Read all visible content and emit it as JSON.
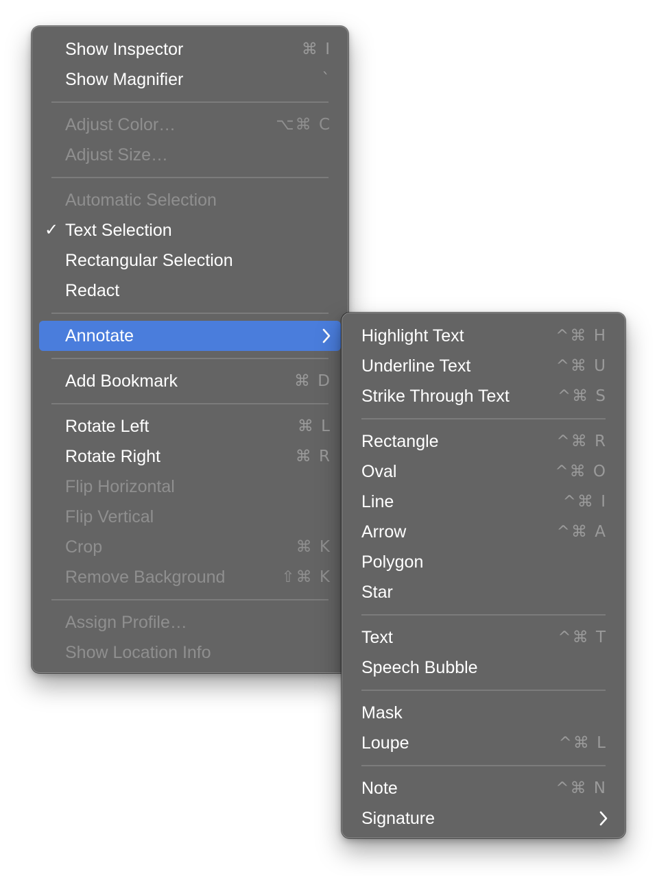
{
  "main_menu": {
    "items": [
      {
        "label": "Show Inspector",
        "shortcut": "⌘ I"
      },
      {
        "label": "Show Magnifier",
        "shortcut": "`"
      },
      {
        "label": "Adjust Color…",
        "shortcut": "⌥⌘ C"
      },
      {
        "label": "Adjust Size…"
      },
      {
        "label": "Automatic Selection"
      },
      {
        "label": "Text Selection",
        "check": "✓"
      },
      {
        "label": "Rectangular Selection"
      },
      {
        "label": "Redact"
      },
      {
        "label": "Annotate"
      },
      {
        "label": "Add Bookmark",
        "shortcut": "⌘ D"
      },
      {
        "label": "Rotate Left",
        "shortcut": "⌘ L"
      },
      {
        "label": "Rotate Right",
        "shortcut": "⌘ R"
      },
      {
        "label": "Flip Horizontal"
      },
      {
        "label": "Flip Vertical"
      },
      {
        "label": "Crop",
        "shortcut": "⌘ K"
      },
      {
        "label": "Remove Background",
        "shortcut": "⇧⌘ K"
      },
      {
        "label": "Assign Profile…"
      },
      {
        "label": "Show Location Info"
      }
    ]
  },
  "annotate_submenu": {
    "items": [
      {
        "label": "Highlight Text",
        "shortcut": "^⌘ H"
      },
      {
        "label": "Underline Text",
        "shortcut": "^⌘ U"
      },
      {
        "label": "Strike Through Text",
        "shortcut": "^⌘ S"
      },
      {
        "label": "Rectangle",
        "shortcut": "^⌘ R"
      },
      {
        "label": "Oval",
        "shortcut": "^⌘ O"
      },
      {
        "label": "Line",
        "shortcut": "^⌘ I"
      },
      {
        "label": "Arrow",
        "shortcut": "^⌘ A"
      },
      {
        "label": "Polygon"
      },
      {
        "label": "Star"
      },
      {
        "label": "Text",
        "shortcut": "^⌘ T"
      },
      {
        "label": "Speech Bubble"
      },
      {
        "label": "Mask"
      },
      {
        "label": "Loupe",
        "shortcut": "^⌘ L"
      },
      {
        "label": "Note",
        "shortcut": "^⌘ N"
      },
      {
        "label": "Signature"
      }
    ]
  },
  "colors": {
    "menu_background": "#646464",
    "highlight": "#4a7ddc",
    "enabled_text": "#ffffff",
    "disabled_text": "#8f8f8f"
  },
  "icons": {
    "check": "checkmark-icon",
    "submenu": "chevron-right-icon"
  }
}
